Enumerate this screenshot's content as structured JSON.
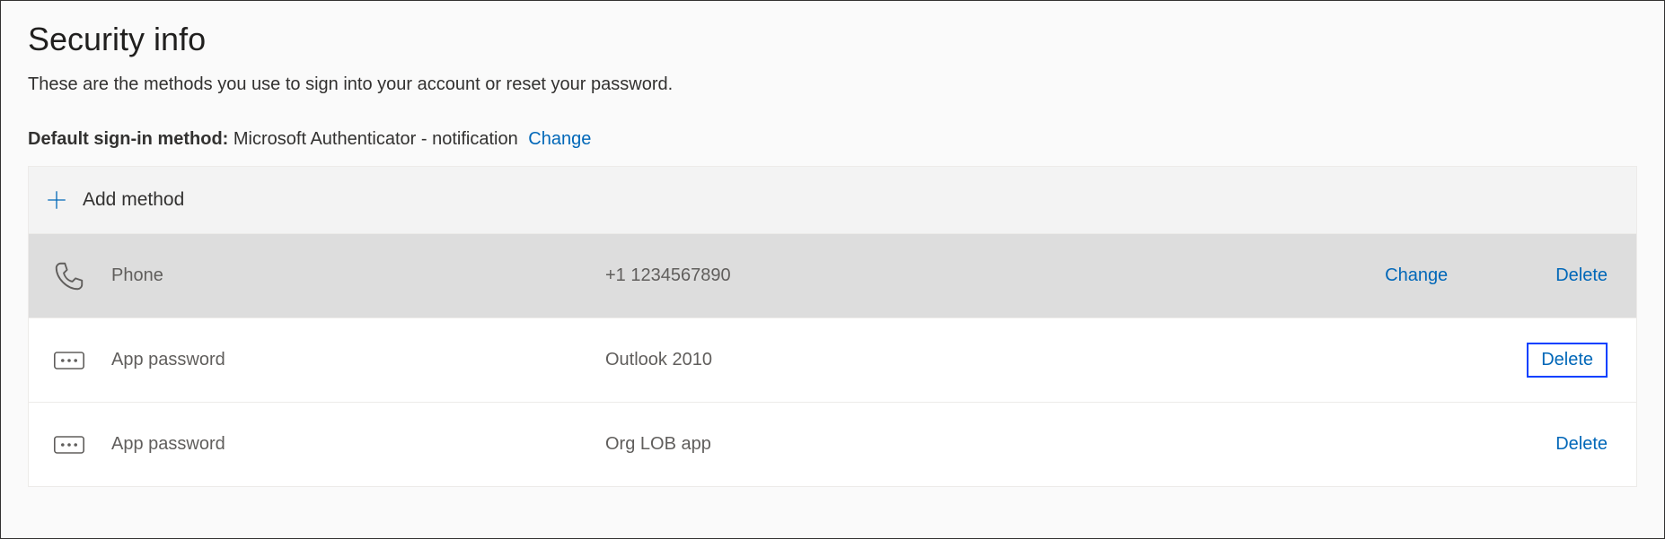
{
  "header": {
    "title": "Security info",
    "subtitle": "These are the methods you use to sign into your account or reset your password."
  },
  "defaultMethod": {
    "label": "Default sign-in method:",
    "value": "Microsoft Authenticator - notification",
    "change_label": "Change"
  },
  "addMethod": {
    "label": "Add method"
  },
  "actions": {
    "change": "Change",
    "delete": "Delete"
  },
  "methods": [
    {
      "type": "Phone",
      "value": "+1 1234567890"
    },
    {
      "type": "App password",
      "value": "Outlook 2010"
    },
    {
      "type": "App password",
      "value": "Org LOB app"
    }
  ]
}
